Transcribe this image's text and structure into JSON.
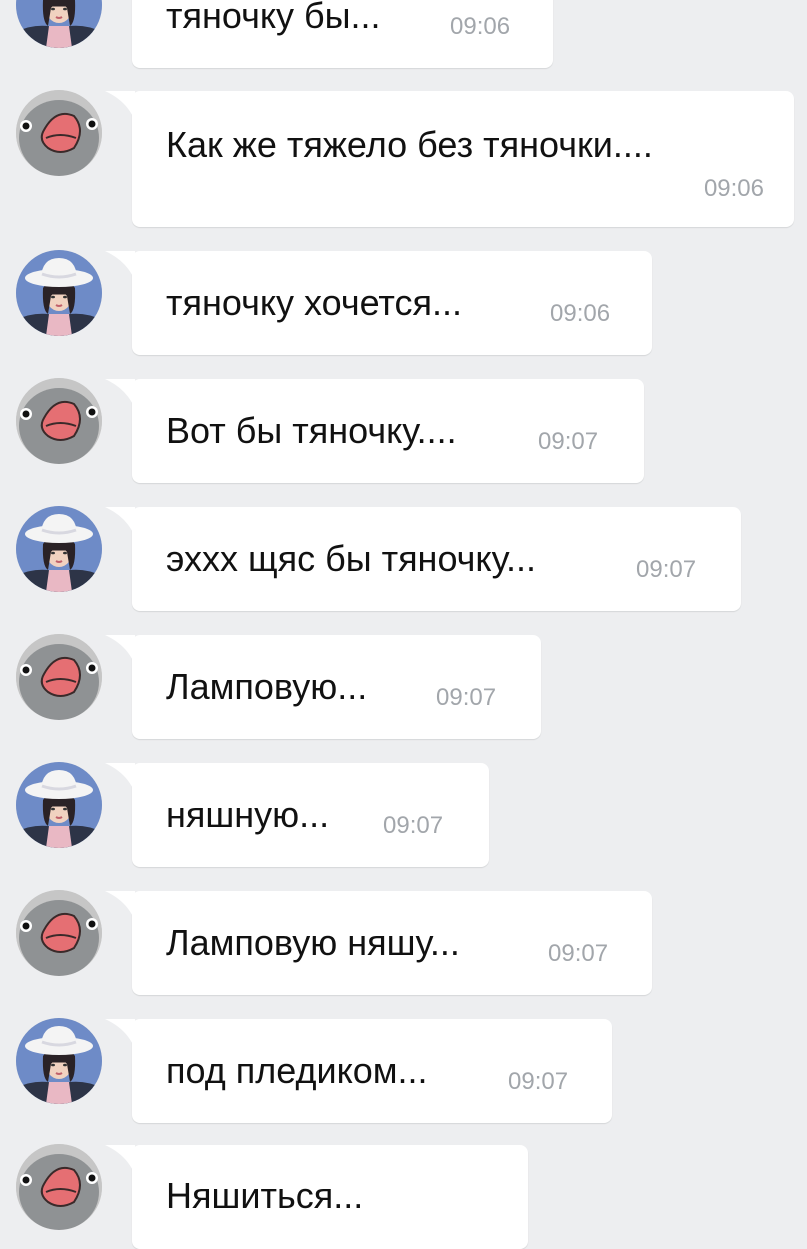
{
  "chat": {
    "messages": [
      {
        "sender": "girl",
        "text": "тяночку бы...",
        "time": "09:06"
      },
      {
        "sender": "bird",
        "text": "Как же тяжело без тяночки....",
        "time": "09:06"
      },
      {
        "sender": "girl",
        "text": "тяночку хочется...",
        "time": "09:06"
      },
      {
        "sender": "bird",
        "text": "Вот бы тяночку....",
        "time": "09:07"
      },
      {
        "sender": "girl",
        "text": "эххх щяс бы тяночку...",
        "time": "09:07"
      },
      {
        "sender": "bird",
        "text": "Ламповую...",
        "time": "09:07"
      },
      {
        "sender": "girl",
        "text": "няшную...",
        "time": "09:07"
      },
      {
        "sender": "bird",
        "text": "Ламповую няшу...",
        "time": "09:07"
      },
      {
        "sender": "girl",
        "text": "под пледиком...",
        "time": "09:07"
      },
      {
        "sender": "bird",
        "text": "Няшиться...",
        "time": ""
      }
    ]
  },
  "avatars": {
    "girl": {
      "icon": "girl-in-white-hat-avatar",
      "hat": "#f4f4f4",
      "hair": "#2a2226",
      "skin": "#f1d2c0",
      "bg": "#6e8bc7",
      "coat": "#2d3447"
    },
    "bird": {
      "icon": "gray-bird-avatar",
      "body": "#8f9294",
      "beak": "#e56f73",
      "bg": "#c6c6c6"
    }
  }
}
